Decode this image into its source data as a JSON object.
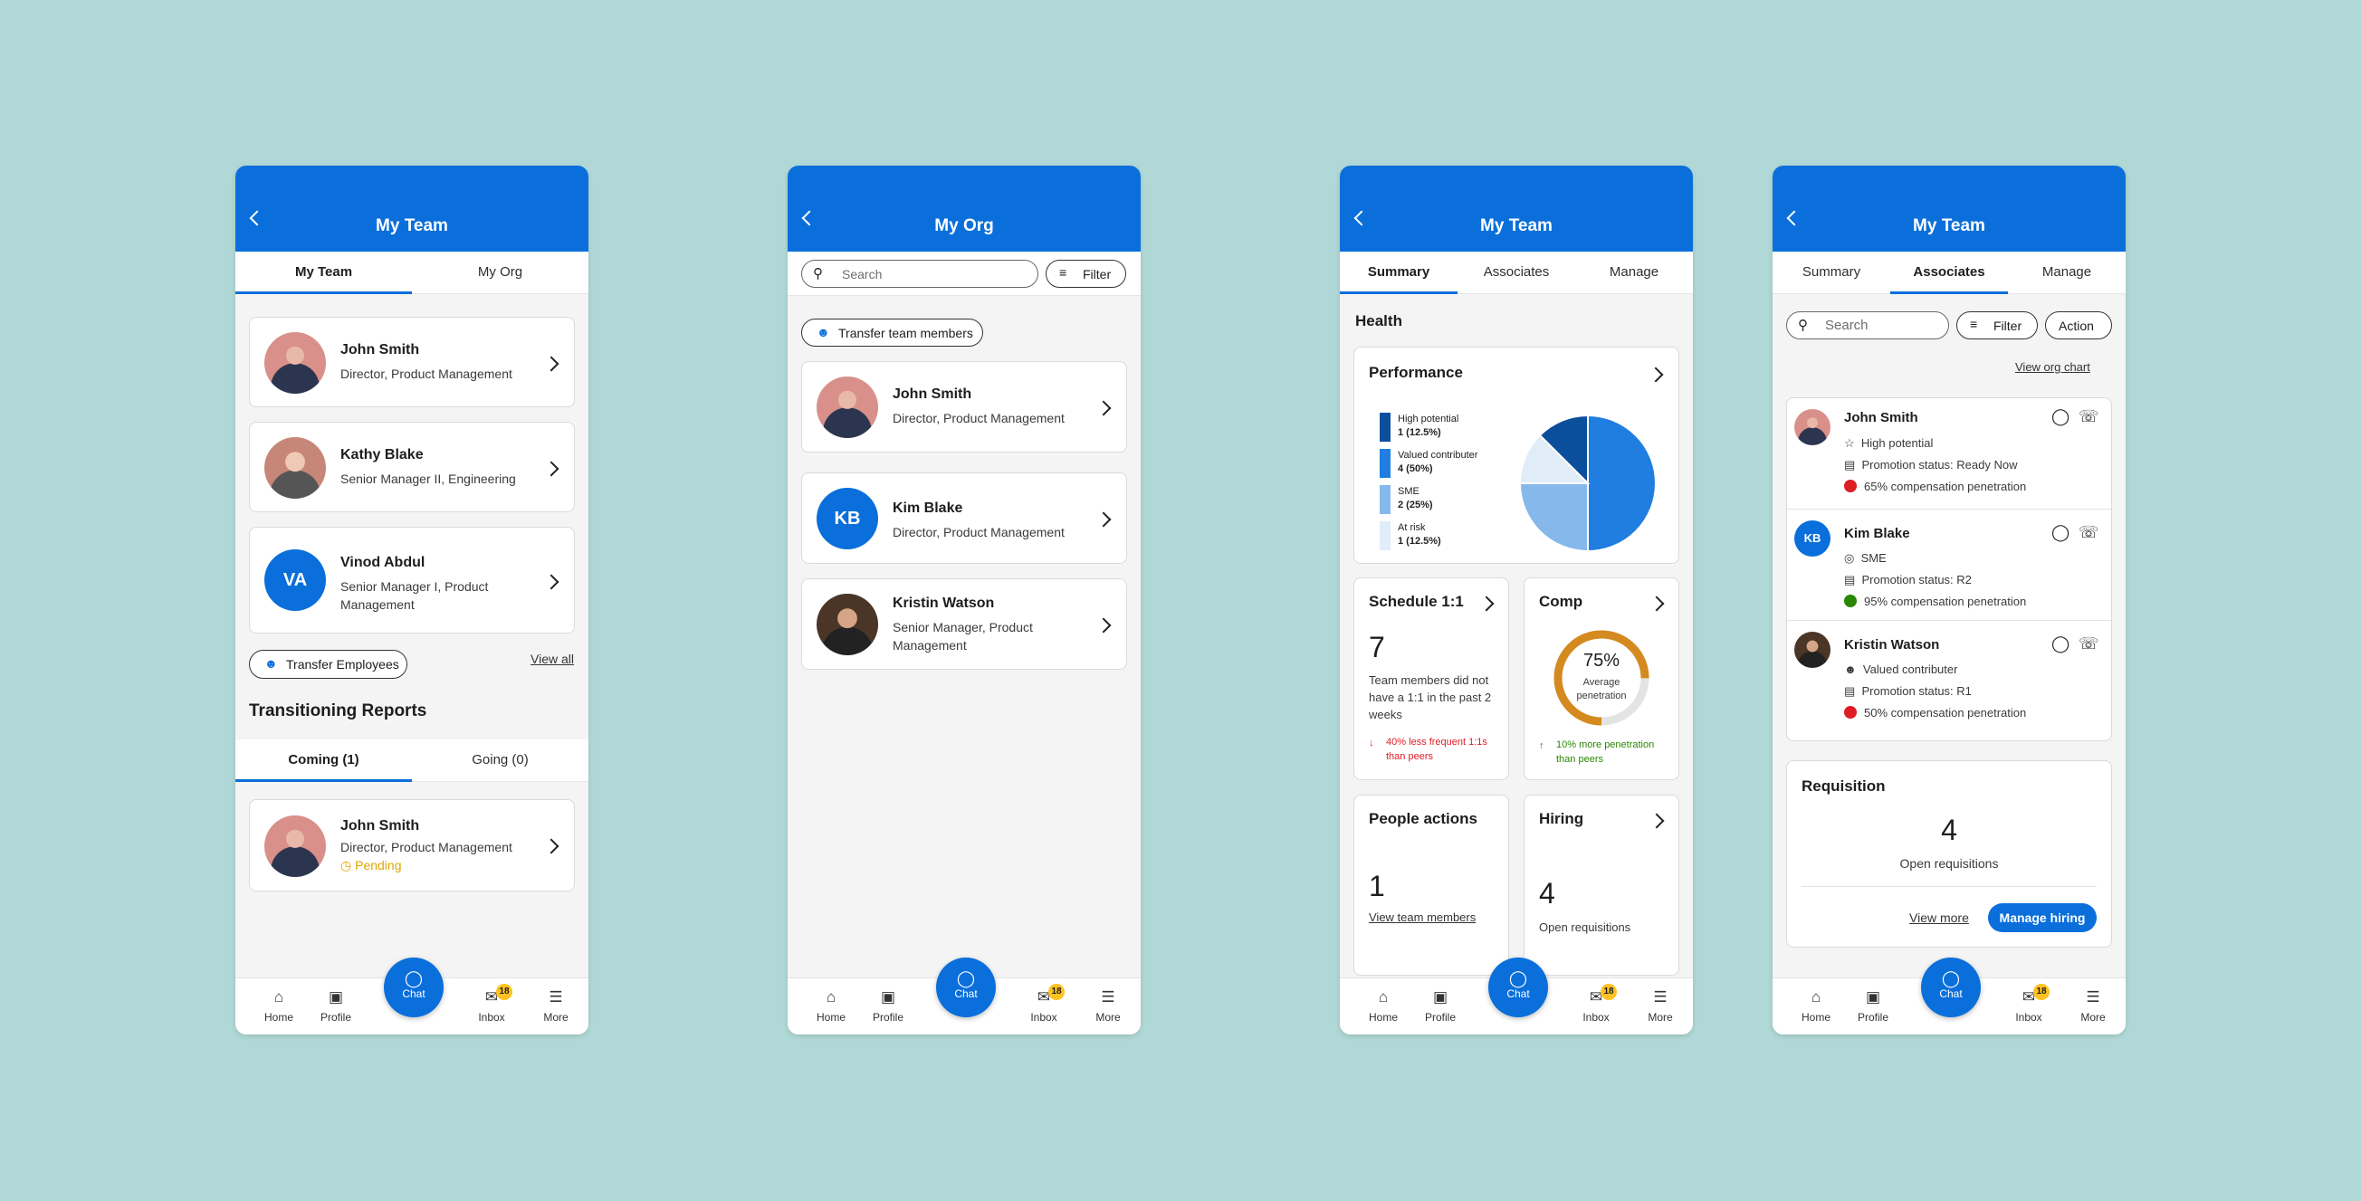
{
  "nav": {
    "home": "Home",
    "profile": "Profile",
    "chat": "Chat",
    "inbox": "Inbox",
    "inbox_badge": "18",
    "more": "More"
  },
  "screen1": {
    "title": "My Team",
    "tabs": [
      "My Team",
      "My Org"
    ],
    "people": [
      {
        "name": "John Smith",
        "role": "Director, Product Management"
      },
      {
        "name": "Kathy Blake",
        "role": "Senior Manager II, Engineering"
      },
      {
        "name": "Vinod Abdul",
        "initials": "VA",
        "role_line1": "Senior Manager I, Product",
        "role_line2": "Management"
      }
    ],
    "transfer_btn": "Transfer Employees",
    "view_all": "View all",
    "transitioning_title": "Transitioning Reports",
    "trans_tabs": [
      "Coming (1)",
      "Going (0)"
    ],
    "trans_person": {
      "name": "John Smith",
      "role": "Director, Product Management",
      "status": "Pending"
    }
  },
  "screen2": {
    "title": "My Org",
    "search_placeholder": "Search",
    "filter": "Filter",
    "transfer_btn": "Transfer team members",
    "people": [
      {
        "name": "John Smith",
        "role": "Director, Product Management"
      },
      {
        "name": "Kim Blake",
        "initials": "KB",
        "role": "Director, Product Management"
      },
      {
        "name": "Kristin Watson",
        "role_line1": "Senior Manager, Product",
        "role_line2": "Management"
      }
    ]
  },
  "screen3": {
    "title": "My Team",
    "tabs": [
      "Summary",
      "Associates",
      "Manage"
    ],
    "health": "Health",
    "performance": "Performance",
    "legend": [
      {
        "label": "High potential",
        "value": "1 (12.5%)",
        "color": "#0b4f9c"
      },
      {
        "label": "Valued contributer",
        "value": "4 (50%)",
        "color": "#1f7ee0"
      },
      {
        "label": "SME",
        "value": "2 (25%)",
        "color": "#86b8ec"
      },
      {
        "label": "At risk",
        "value": "1 (12.5%)",
        "color": "#e1ecf9"
      }
    ],
    "schedule": {
      "title": "Schedule 1:1",
      "value": "7",
      "desc_lines": [
        "Team members did not",
        "have a 1:1 in the past 2",
        "weeks"
      ],
      "trend_lines": [
        "40% less frequent 1:1s",
        "than peers"
      ]
    },
    "comp": {
      "title": "Comp",
      "percent": "75%",
      "percent_value": 75,
      "label_lines": [
        "Average",
        "penetration"
      ],
      "trend_lines": [
        "10% more penetration",
        "than peers"
      ]
    },
    "people_actions": {
      "title": "People actions",
      "value": "1",
      "link": "View team members"
    },
    "hiring": {
      "title": "Hiring",
      "value": "4",
      "desc": "Open requisitions"
    }
  },
  "screen4": {
    "title": "My Team",
    "tabs": [
      "Summary",
      "Associates",
      "Manage"
    ],
    "search_placeholder": "Search",
    "filter": "Filter",
    "action": "Action",
    "org_chart": "View org chart",
    "associates": [
      {
        "name": "John Smith",
        "tag": "High potential",
        "promotion": "Promotion status: Ready Now",
        "comp": "65% compensation penetration",
        "comp_color": "#de1c24"
      },
      {
        "name": "Kim Blake",
        "initials": "KB",
        "tag": "SME",
        "promotion": "Promotion status: R2",
        "comp": "95% compensation penetration",
        "comp_color": "#2a8703"
      },
      {
        "name": "Kristin Watson",
        "tag": "Valued contributer",
        "promotion": "Promotion status: R1",
        "comp": "50% compensation penetration",
        "comp_color": "#de1c24"
      }
    ],
    "requisition": {
      "title": "Requisition",
      "value": "4",
      "desc": "Open requisitions",
      "view_more": "View more",
      "manage": "Manage hiring"
    }
  }
}
